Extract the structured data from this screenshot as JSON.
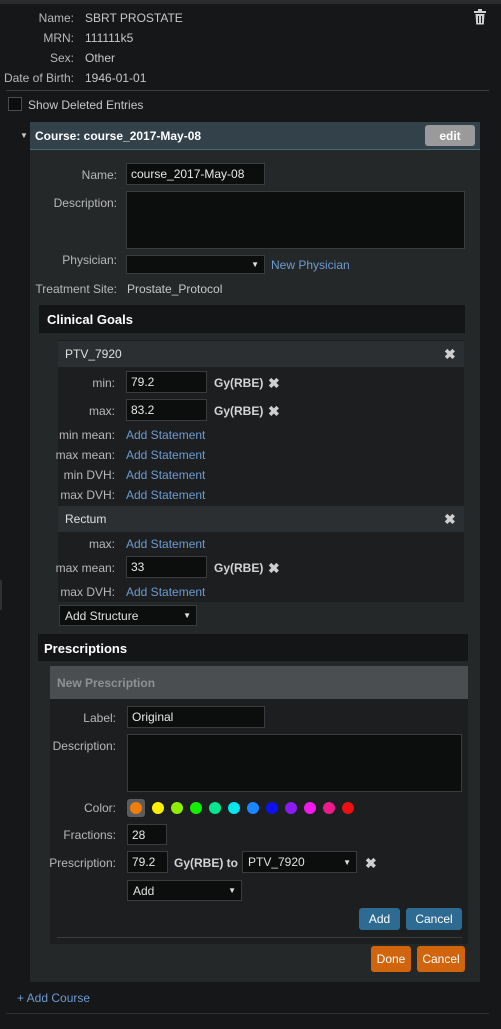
{
  "patient": {
    "name_label": "Name:",
    "name": "SBRT PROSTATE",
    "mrn_label": "MRN:",
    "mrn": "111111k5",
    "sex_label": "Sex:",
    "sex": "Other",
    "dob_label": "Date of Birth:",
    "dob": "1946-01-01"
  },
  "show_deleted_label": "Show Deleted Entries",
  "course": {
    "title": "Course: course_2017-May-08",
    "edit_label": "edit",
    "name_label": "Name:",
    "name_value": "course_2017-May-08",
    "description_label": "Description:",
    "description_value": "",
    "physician_label": "Physician:",
    "physician_value": "",
    "new_physician_label": "New Physician",
    "treatment_site_label": "Treatment Site:",
    "treatment_site_value": "Prostate_Protocol"
  },
  "clinical_goals": {
    "header": "Clinical Goals",
    "structures": [
      {
        "name": "PTV_7920",
        "min_label": "min:",
        "min_value": "79.2",
        "min_unit": "Gy(RBE)",
        "max_label": "max:",
        "max_value": "83.2",
        "max_unit": "Gy(RBE)",
        "min_mean_label": "min mean:",
        "max_mean_label": "max mean:",
        "min_dvh_label": "min DVH:",
        "max_dvh_label": "max DVH:",
        "add_statement": "Add Statement"
      },
      {
        "name": "Rectum",
        "max_label": "max:",
        "max_mean_label": "max mean:",
        "max_mean_value": "33",
        "max_mean_unit": "Gy(RBE)",
        "max_dvh_label": "max DVH:",
        "add_statement": "Add Statement"
      }
    ],
    "add_structure_label": "Add Structure"
  },
  "prescriptions": {
    "header": "Prescriptions",
    "new_header": "New Prescription",
    "label_label": "Label:",
    "label_value": "Original",
    "description_label": "Description:",
    "description_value": "",
    "color_label": "Color:",
    "colors": [
      "#f07d0c",
      "#ffef00",
      "#8fef00",
      "#12ef00",
      "#00e78f",
      "#00e7ef",
      "#1a86ff",
      "#0c10f2",
      "#8c1af2",
      "#f01aef",
      "#ee1a8a",
      "#ee1010"
    ],
    "fractions_label": "Fractions:",
    "fractions_value": "28",
    "prescription_label": "Prescription:",
    "prescription_value": "79.2",
    "prescription_unit": "Gy(RBE) to",
    "prescription_target": "PTV_7920",
    "add_select_label": "Add",
    "add_button": "Add",
    "cancel_button": "Cancel"
  },
  "done_button": "Done",
  "course_cancel_button": "Cancel",
  "add_course_label": "+ Add Course"
}
